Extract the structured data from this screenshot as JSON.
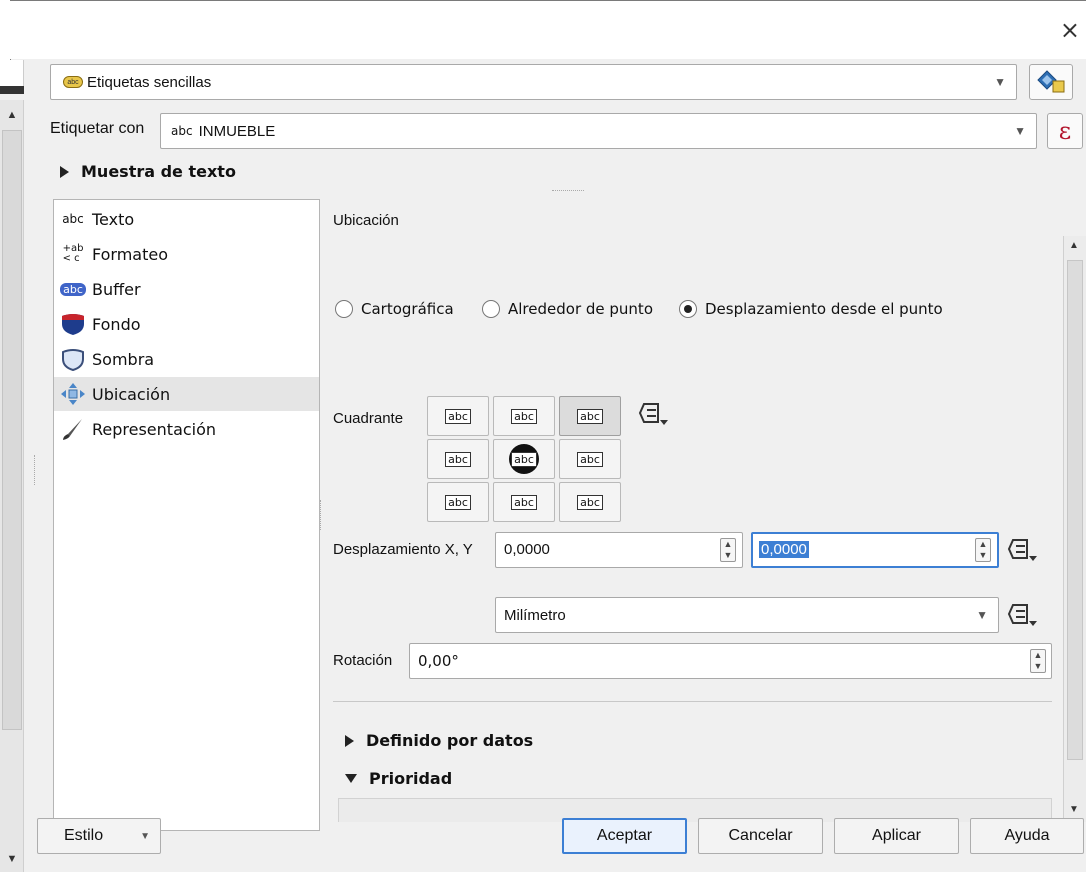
{
  "window": {
    "close_glyph": "×"
  },
  "top": {
    "renderer_value": "Etiquetas sencillas",
    "renderer_badge": "abc",
    "label_with_label": "Etiquetar con",
    "label_with_prefix": "abc",
    "label_with_value": "INMUEBLE",
    "epsilon": "ε",
    "sample_text_label": "Muestra de texto"
  },
  "sidebar": {
    "items": [
      {
        "label": "Texto",
        "icon": "abc-text-icon"
      },
      {
        "label": "Formateo",
        "icon": "formatting-icon"
      },
      {
        "label": "Buffer",
        "icon": "buffer-icon"
      },
      {
        "label": "Fondo",
        "icon": "background-shield-icon"
      },
      {
        "label": "Sombra",
        "icon": "shadow-icon"
      },
      {
        "label": "Ubicación",
        "icon": "placement-arrows-icon",
        "selected": true
      },
      {
        "label": "Representación",
        "icon": "brush-icon"
      }
    ],
    "text_icon_glyph": "abc",
    "format_icon_top": "+ab",
    "format_icon_bottom": "< c",
    "buffer_icon_glyph": "abc"
  },
  "placement": {
    "section_title": "Ubicación",
    "modes": [
      {
        "label": "Cartográfica",
        "checked": false
      },
      {
        "label": "Alrededor de punto",
        "checked": false
      },
      {
        "label": "Desplazamiento desde el punto",
        "checked": true
      }
    ],
    "quadrant_label": "Cuadrante",
    "quadrant_glyph": "abc",
    "offset_label": "Desplazamiento X, Y",
    "offset_x": "0,0000",
    "offset_y": "0,0000",
    "unit_value": "Milímetro",
    "rotation_label": "Rotación",
    "rotation_value": "0,00°",
    "data_defined_label": "Definido por datos",
    "priority_label": "Prioridad"
  },
  "footer": {
    "style_label": "Estilo",
    "ok": "Aceptar",
    "cancel": "Cancelar",
    "apply": "Aplicar",
    "help": "Ayuda"
  },
  "colors": {
    "accent": "#3c7fd4",
    "selection": "#3c7fd4"
  }
}
